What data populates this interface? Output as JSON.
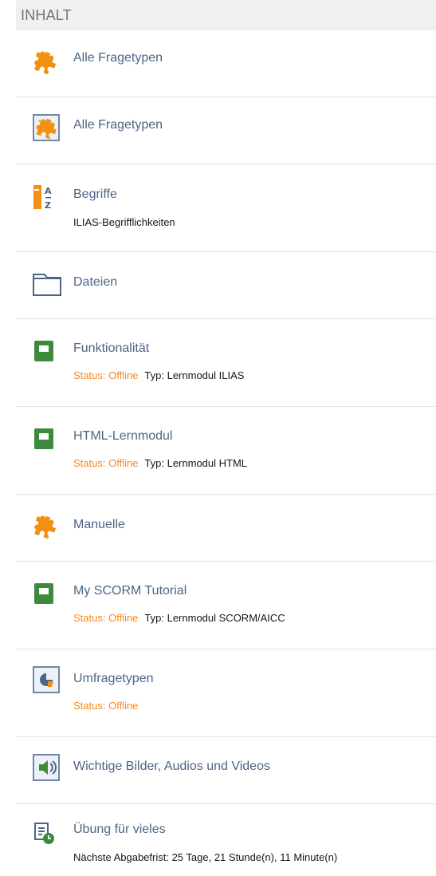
{
  "section_title": "INHALT",
  "items": [
    {
      "title": "Alle Fragetypen",
      "icon": "puzzle-icon"
    },
    {
      "title": "Alle Fragetypen",
      "icon": "puzzle-framed-icon"
    },
    {
      "title": "Begriffe",
      "icon": "glossary-icon",
      "description": "ILIAS-Begrifflichkeiten"
    },
    {
      "title": "Dateien",
      "icon": "folder-icon"
    },
    {
      "title": "Funktionalität",
      "icon": "learning-module-icon",
      "status": "Status: Offline",
      "type": "Typ: Lernmodul ILIAS"
    },
    {
      "title": "HTML-Lernmodul",
      "icon": "learning-module-icon",
      "status": "Status: Offline",
      "type": "Typ: Lernmodul HTML"
    },
    {
      "title": "Manuelle",
      "icon": "puzzle-icon"
    },
    {
      "title": "My SCORM Tutorial",
      "icon": "learning-module-icon",
      "status": "Status: Offline",
      "type": "Typ: Lernmodul SCORM/AICC"
    },
    {
      "title": "Umfragetypen",
      "icon": "survey-icon",
      "status": "Status: Offline"
    },
    {
      "title": "Wichtige Bilder, Audios und Videos",
      "icon": "media-pool-icon"
    },
    {
      "title": "Übung für vieles",
      "icon": "exercise-icon",
      "deadline": "Nächste Abgabefrist: 25 Tage, 21 Stunde(n), 11 Minute(n)"
    }
  ],
  "colors": {
    "link": "#4c6586",
    "offline": "#f48b24",
    "puzzle": "#f29111",
    "module": "#3e8a3c"
  }
}
